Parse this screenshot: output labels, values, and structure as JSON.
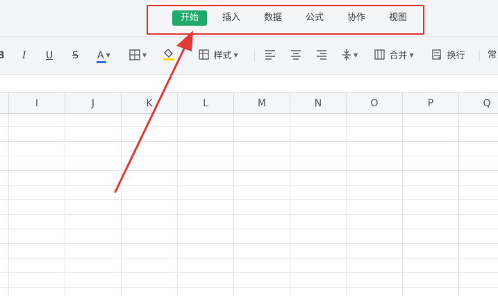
{
  "menu": {
    "tabs": [
      {
        "label": "开始",
        "active": true
      },
      {
        "label": "插入",
        "active": false
      },
      {
        "label": "数据",
        "active": false
      },
      {
        "label": "公式",
        "active": false
      },
      {
        "label": "协作",
        "active": false
      },
      {
        "label": "视图",
        "active": false
      }
    ]
  },
  "toolbar": {
    "bold": "B",
    "italic": "I",
    "underline": "U",
    "strike": "S",
    "font_color": "A",
    "style_label": "样式",
    "merge_label": "合并",
    "wrap_label": "换行",
    "more_label": "常"
  },
  "columns": [
    "I",
    "J",
    "K",
    "L",
    "M",
    "N",
    "O",
    "P",
    "Q"
  ],
  "colors": {
    "active_tab": "#1faa6b",
    "highlight": "#e53935",
    "font_color_bar": "#2f6fe4",
    "fill_color_bar": "#f5d90a"
  }
}
